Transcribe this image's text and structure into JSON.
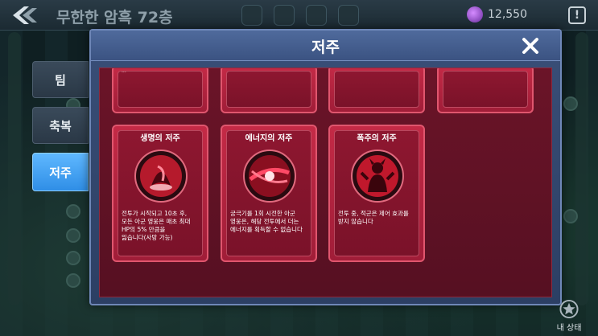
{
  "header": {
    "floor_title": "무한한 암흑 72층",
    "currency_value": "12,550",
    "alert_symbol": "!"
  },
  "side_tabs": [
    {
      "label": "팀"
    },
    {
      "label": "축복"
    },
    {
      "label": "저주",
      "active": true
    }
  ],
  "dialog": {
    "title": "저주",
    "partial_card_text": "...",
    "curses": [
      {
        "name": "생명의 저주",
        "icon": "life-curse-icon",
        "description": "전투가 시작되고 10초 후,\n모든 아군 영웅은 매초 최대\nHP의 5% 만큼을\n잃습니다(사망 가능)"
      },
      {
        "name": "에너지의 저주",
        "icon": "energy-curse-icon",
        "description": "궁극기를 1회 시전한 아군\n영웅은, 해당 전투에서 더는\n에너지를 획득할 수 없습니다"
      },
      {
        "name": "폭주의 저주",
        "icon": "rampage-curse-icon",
        "description": "전투 중, 적군은 제어 효과를\n받지 않습니다"
      }
    ]
  },
  "status_button": {
    "label": "내 상태"
  },
  "colors": {
    "card_red": "#c42a46",
    "panel_red": "#6b1428",
    "dialog_blue": "#3a4f78",
    "active_tab_blue": "#2f8ee6"
  }
}
